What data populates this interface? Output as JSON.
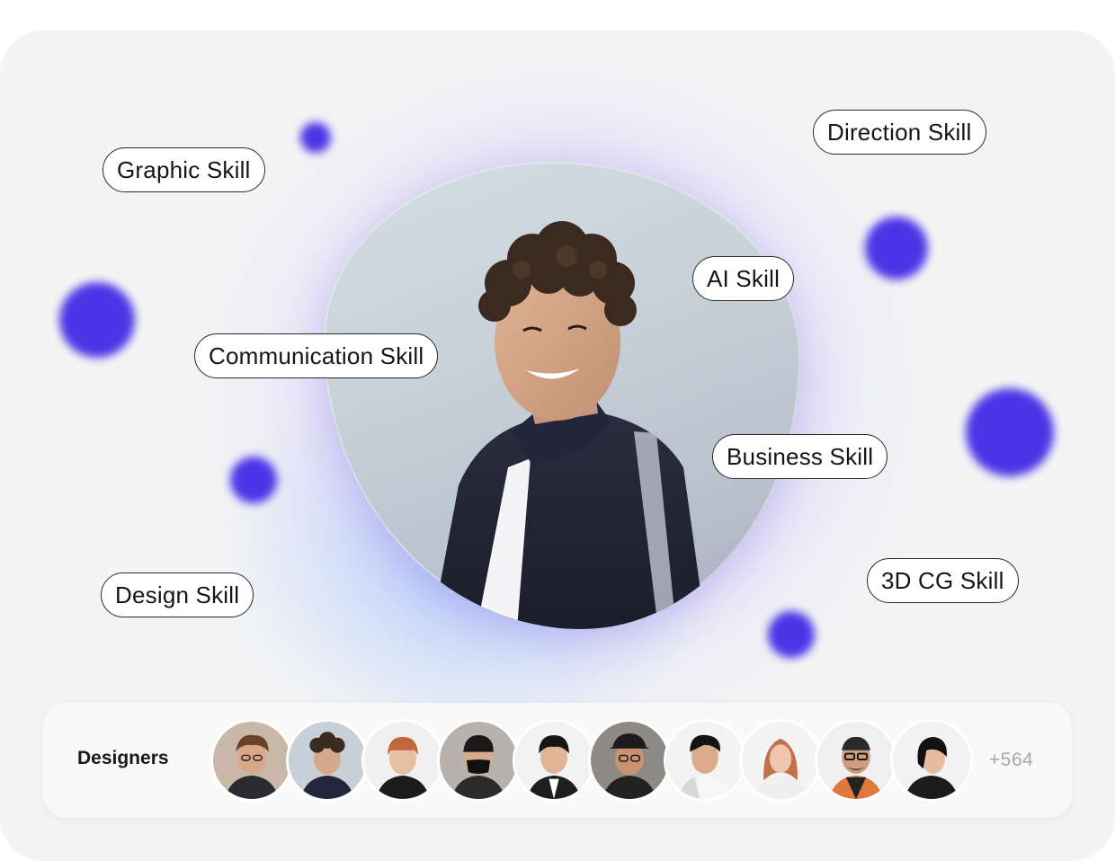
{
  "skills": {
    "graphic": "Graphic  Skill",
    "direction": "Direction Skill",
    "ai": "AI Skill",
    "communication": "Communication Skill",
    "business": "Business Skill",
    "design": "Design Skill",
    "cg3d": "3D CG Skill"
  },
  "designers_bar": {
    "label": "Designers",
    "more_count": "+564"
  },
  "colors": {
    "accent_dot": "#4a35e6",
    "glow_violet": "#8c6eff",
    "card_background": "#f4f4f5"
  }
}
